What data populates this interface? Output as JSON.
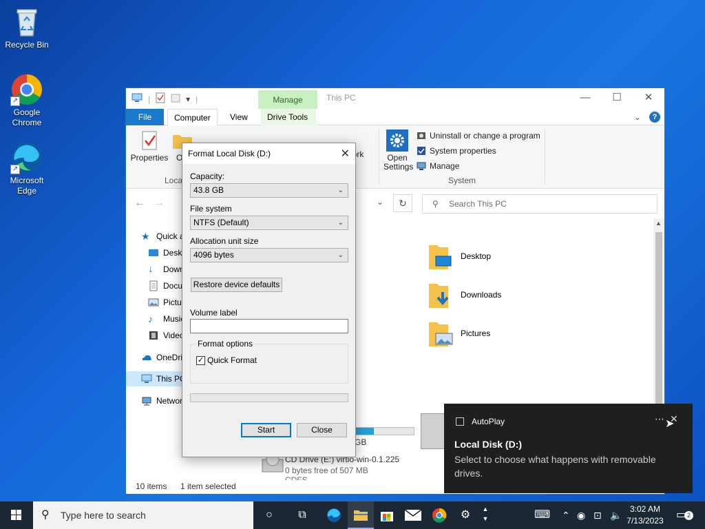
{
  "desktop": {
    "icons": [
      {
        "label": "Recycle Bin"
      },
      {
        "label": "Google Chrome"
      },
      {
        "label": "Microsoft Edge"
      }
    ]
  },
  "explorer": {
    "title": "This PC",
    "manage_tab": "Manage",
    "tabs": {
      "file": "File",
      "computer": "Computer",
      "view": "View",
      "drive_tools": "Drive Tools"
    },
    "ribbon": {
      "properties": "Properties",
      "open_partial": "Op",
      "location_group": "Locat",
      "network_partial_1": "work",
      "network_partial_2": "n",
      "open_settings_1": "Open",
      "open_settings_2": "Settings",
      "uninstall": "Uninstall or change a program",
      "system_properties": "System properties",
      "manage": "Manage",
      "system_group": "System"
    },
    "search_placeholder": "Search This PC",
    "nav": [
      {
        "label": "Quick a"
      },
      {
        "label": "Deskt"
      },
      {
        "label": "Down"
      },
      {
        "label": "Docu"
      },
      {
        "label": "Pictur"
      },
      {
        "label": "Music"
      },
      {
        "label": "Video"
      },
      {
        "label": "OneDri"
      },
      {
        "label": "This PC"
      },
      {
        "label": "Networ"
      }
    ],
    "folders": [
      {
        "label": "Desktop"
      },
      {
        "label": "Downloads"
      },
      {
        "label": "Pictures"
      }
    ],
    "drives": {
      "d_size_partial": "GB",
      "cd_name": "CD Drive (E:) virtio-win-0.1.225",
      "cd_free": "0 bytes free of 507 MB",
      "cd_fs": "CDFS"
    },
    "status": {
      "items": "10 items",
      "selected": "1 item selected"
    }
  },
  "dialog": {
    "title": "Format Local Disk (D:)",
    "capacity_label": "Capacity:",
    "capacity_value": "43.8 GB",
    "filesystem_label": "File system",
    "filesystem_value": "NTFS (Default)",
    "alloc_label": "Allocation unit size",
    "alloc_value": "4096 bytes",
    "restore_button": "Restore device defaults",
    "volume_label": "Volume label",
    "volume_value": "",
    "format_options": "Format options",
    "quick_format": "Quick Format",
    "quick_format_checked": true,
    "progress": 0,
    "start_button": "Start",
    "close_button": "Close"
  },
  "toast": {
    "app": "AutoPlay",
    "heading": "Local Disk (D:)",
    "body": "Select to choose what happens with removable drives."
  },
  "taskbar": {
    "search_placeholder": "Type here to search",
    "time": "3:02 AM",
    "date": "7/13/2023",
    "notifications": "2"
  },
  "colors": {
    "accent": "#0078d7",
    "taskbar": "#1c2735",
    "desktop": "#1565d8"
  }
}
